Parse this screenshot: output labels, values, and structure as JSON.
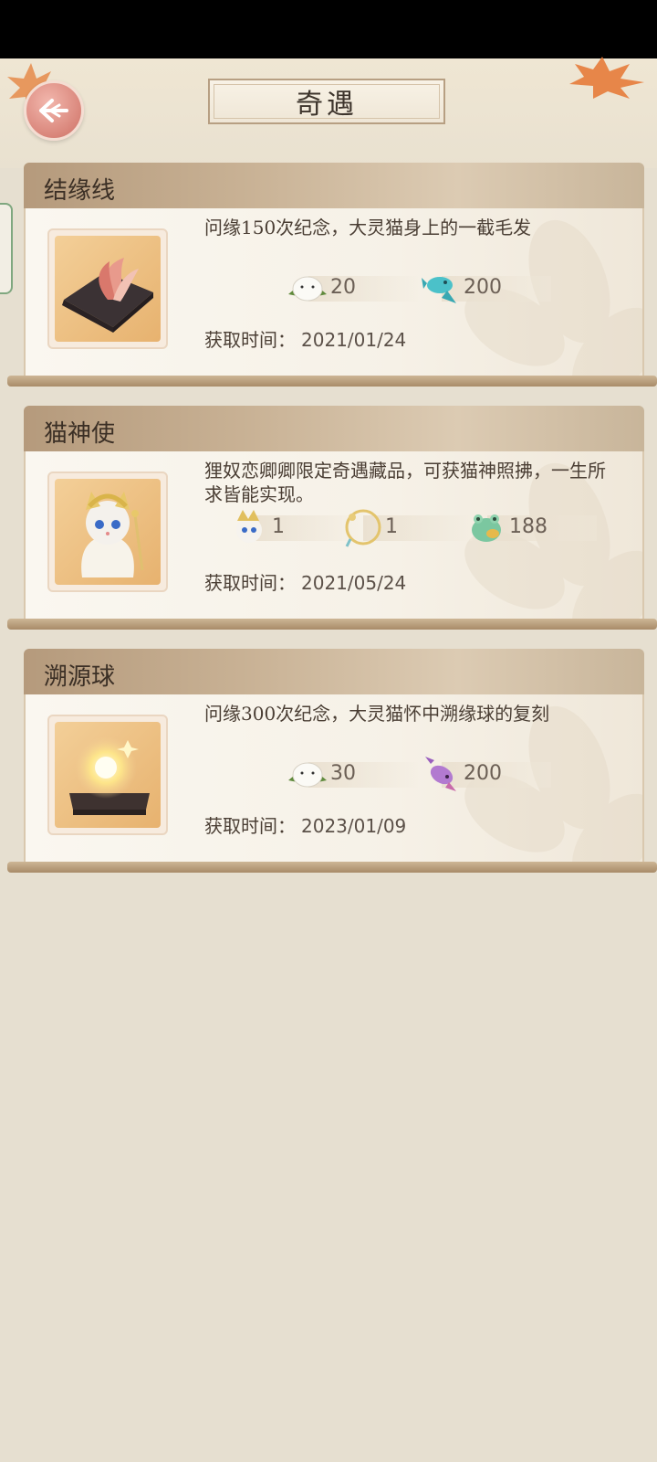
{
  "header": {
    "title": "奇遇"
  },
  "cards": [
    {
      "title": "结缘线",
      "desc": "问缘150次纪念，大灵猫身上的一截毛发",
      "rewards": [
        {
          "icon": "white-mochi-icon",
          "value": "20"
        },
        {
          "icon": "blue-fish-icon",
          "value": "200"
        }
      ],
      "acq_label": "获取时间：",
      "date": "2021/01/24"
    },
    {
      "title": "猫神使",
      "desc": "狸奴恋卿卿限定奇遇藏品，可获猫神照拂，一生所求皆能实现。",
      "rewards": [
        {
          "icon": "cat-deity-icon",
          "value": "1"
        },
        {
          "icon": "gold-ring-frame-icon",
          "value": "1"
        },
        {
          "icon": "jade-frog-icon",
          "value": "188"
        }
      ],
      "acq_label": "获取时间：",
      "date": "2021/05/24"
    },
    {
      "title": "溯源球",
      "desc": "问缘300次纪念，大灵猫怀中溯缘球的复刻",
      "rewards": [
        {
          "icon": "white-mochi-icon",
          "value": "30"
        },
        {
          "icon": "purple-fish-icon",
          "value": "200"
        }
      ],
      "acq_label": "获取时间：",
      "date": "2023/01/09"
    }
  ],
  "colors": {
    "accent": "#d9857a",
    "card_header": "#c8b194",
    "background": "#e6dfd0"
  }
}
